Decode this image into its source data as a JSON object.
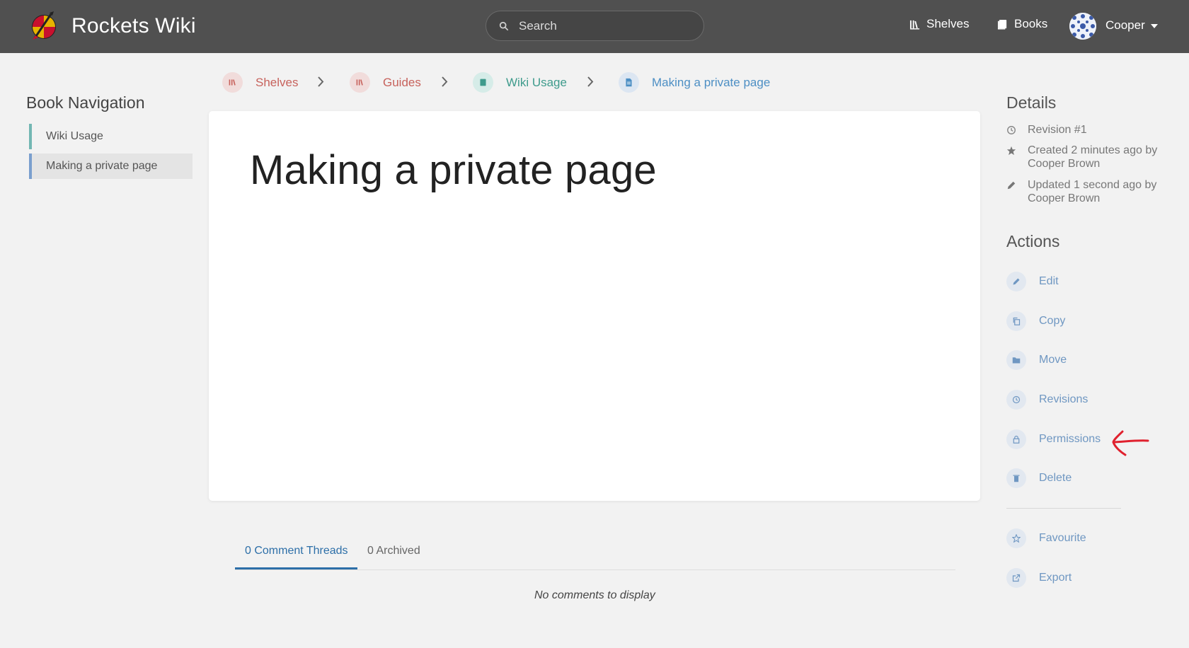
{
  "header": {
    "site_title": "Rockets Wiki",
    "search_placeholder": "Search",
    "nav": [
      {
        "label": "Shelves",
        "icon": "shelves-icon"
      },
      {
        "label": "Books",
        "icon": "books-icon"
      }
    ],
    "user": {
      "name": "Cooper"
    }
  },
  "book_navigation": {
    "title": "Book Navigation",
    "items": [
      {
        "label": "Wiki Usage",
        "active": false
      },
      {
        "label": "Making a private page",
        "active": true
      }
    ]
  },
  "breadcrumbs": [
    {
      "label": "Shelves",
      "type": "shelf",
      "color": "#c7625c"
    },
    {
      "label": "Guides",
      "type": "shelf",
      "color": "#c7625c"
    },
    {
      "label": "Wiki Usage",
      "type": "book",
      "color": "#3e9b8c"
    },
    {
      "label": "Making a private page",
      "type": "page",
      "color": "#4d8fc4"
    }
  ],
  "page": {
    "title": "Making a private page"
  },
  "comments": {
    "tabs": [
      {
        "label": "0 Comment Threads",
        "active": true
      },
      {
        "label": "0 Archived",
        "active": false
      }
    ],
    "empty_text": "No comments to display"
  },
  "details": {
    "title": "Details",
    "revision": "Revision #1",
    "created": "Created 2 minutes ago by Cooper Brown",
    "updated": "Updated 1 second ago by Cooper Brown"
  },
  "actions": {
    "title": "Actions",
    "items": [
      {
        "label": "Edit",
        "icon": "pencil-icon"
      },
      {
        "label": "Copy",
        "icon": "copy-icon"
      },
      {
        "label": "Move",
        "icon": "folder-icon"
      },
      {
        "label": "Revisions",
        "icon": "history-icon"
      },
      {
        "label": "Permissions",
        "icon": "lock-icon"
      },
      {
        "label": "Delete",
        "icon": "trash-icon"
      }
    ],
    "secondary": [
      {
        "label": "Favourite",
        "icon": "star-icon"
      },
      {
        "label": "Export",
        "icon": "export-icon"
      }
    ]
  },
  "colors": {
    "header_bg": "#505050",
    "shelf": "#c7625c",
    "book": "#3e9b8c",
    "page": "#4d8fc4",
    "action_link": "#6f97c2",
    "annotation": "#e0212e"
  }
}
